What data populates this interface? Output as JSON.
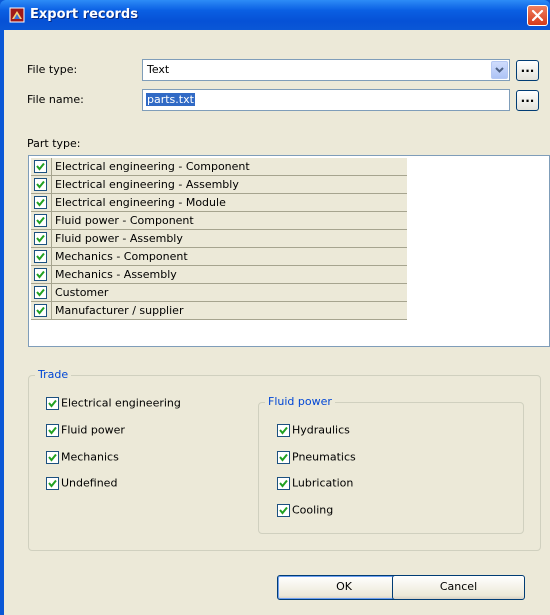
{
  "window": {
    "title": "Export records",
    "close_icon": "close-icon"
  },
  "file_type": {
    "label": "File type:",
    "value": "Text",
    "browse_label": "..."
  },
  "file_name": {
    "label": "File name:",
    "value": "parts.txt",
    "browse_label": "..."
  },
  "part_type": {
    "label": "Part type:",
    "items": [
      {
        "label": "Electrical engineering - Component",
        "checked": true
      },
      {
        "label": "Electrical engineering - Assembly",
        "checked": true
      },
      {
        "label": "Electrical engineering - Module",
        "checked": true
      },
      {
        "label": "Fluid power - Component",
        "checked": true
      },
      {
        "label": "Fluid power - Assembly",
        "checked": true
      },
      {
        "label": "Mechanics - Component",
        "checked": true
      },
      {
        "label": "Mechanics - Assembly",
        "checked": true
      },
      {
        "label": "Customer",
        "checked": true
      },
      {
        "label": "Manufacturer / supplier",
        "checked": true
      }
    ]
  },
  "trade": {
    "title": "Trade",
    "items": [
      {
        "label": "Electrical engineering",
        "checked": true
      },
      {
        "label": "Fluid power",
        "checked": true
      },
      {
        "label": "Mechanics",
        "checked": true
      },
      {
        "label": "Undefined",
        "checked": true
      }
    ]
  },
  "fluid_power": {
    "title": "Fluid power",
    "items": [
      {
        "label": "Hydraulics",
        "checked": true
      },
      {
        "label": "Pneumatics",
        "checked": true
      },
      {
        "label": "Lubrication",
        "checked": true
      },
      {
        "label": "Cooling",
        "checked": true
      }
    ]
  },
  "buttons": {
    "ok": "OK",
    "cancel": "Cancel"
  },
  "colors": {
    "title_bar": "#0a57d6",
    "dialog_bg": "#ece9d8",
    "group_title": "#0046d5",
    "selection": "#316ac5"
  }
}
